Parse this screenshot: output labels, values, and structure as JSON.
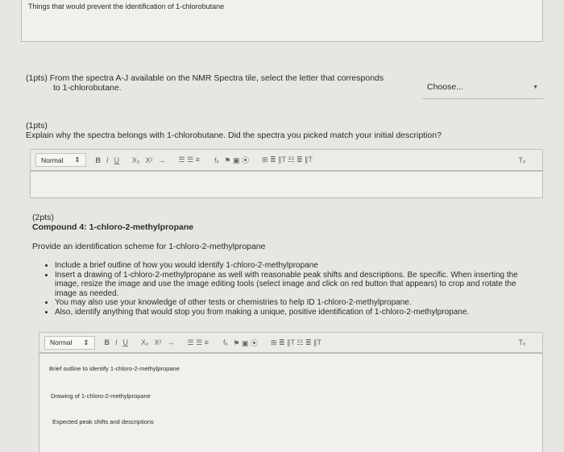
{
  "top_box": {
    "text": "Things that would prevent the identification of 1-chlorobutane"
  },
  "q1": {
    "label": "(1pts) From the spectra A-J available on the NMR Spectra tile, select the letter that corresponds",
    "label2": "to 1-chlorobutane.",
    "select_value": "Choose..."
  },
  "q2": {
    "points": "(1pts)",
    "prompt": "Explain why the spectra belongs with 1-chlorobutane. Did the spectra you picked match your initial description?"
  },
  "toolbar": {
    "style_select": "Normal",
    "bold": "B",
    "italic": "I",
    "underline": "U",
    "subscript": "X₂",
    "superscript": "X²",
    "arrow": "→",
    "lists": "☰ ☰ ≡",
    "formula": "fₓ",
    "link_img": "⚑ ▣ ⦿",
    "table": "⊞ ≣ ∥T ☷ ≣ ∥T",
    "clear": "Tₓ"
  },
  "q3": {
    "points": "(2pts)",
    "title": "Compound 4: 1-chloro-2-methylpropane",
    "provide": "Provide an identification scheme for 1-chloro-2-methylpropane",
    "bullets": [
      "Include a brief outline of how you would identify 1-chloro-2-methylpropane",
      "Insert a drawing of 1-chloro-2-methylpropane as well with reasonable peak shifts and descriptions. Be specific. When inserting the image, resize the image and use the image editing tools (select image and click on red button that appears) to crop and rotate the image as needed.",
      "You may also use your knowledge of other tests or chemistries to help ID 1-chloro-2-methylpropane.",
      "Also, identify anything that would stop you from making a unique, positive identification of 1-chloro-2-methylpropane."
    ],
    "editor_lines": [
      "Brief outline to identify 1-chloro-2-methylpropane",
      "Drawing of 1-chloro-2-methylpropane",
      "Expected peak shifts and descriptions"
    ]
  }
}
